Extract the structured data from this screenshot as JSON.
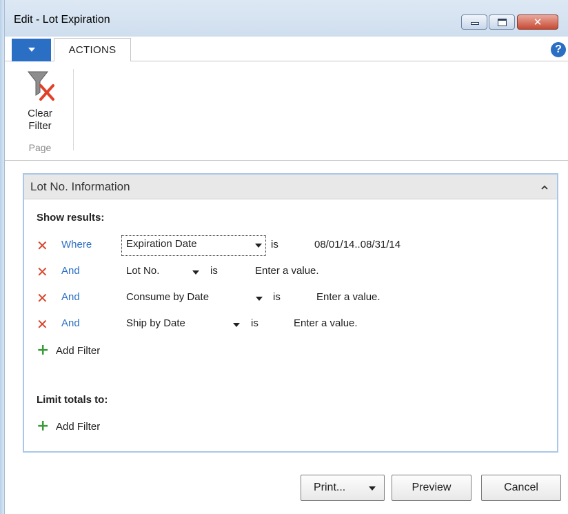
{
  "window": {
    "title": "Edit - Lot Expiration"
  },
  "ribbon": {
    "menu_icon": "dropdown-caret-icon",
    "tabs": [
      {
        "label": "ACTIONS"
      }
    ],
    "help_glyph": "?",
    "actions": [
      {
        "label_line1": "Clear",
        "label_line2": "Filter",
        "icon": "clear-filter-icon"
      }
    ],
    "group_label": "Page"
  },
  "fasttab": {
    "title": "Lot No. Information",
    "show_results_label": "Show results:",
    "filters": [
      {
        "connector": "Where",
        "field": "Expiration Date",
        "operator": "is",
        "value": "08/01/14..08/31/14"
      },
      {
        "connector": "And",
        "field": "Lot No.",
        "operator": "is",
        "value": "Enter a value."
      },
      {
        "connector": "And",
        "field": "Consume by Date",
        "operator": "is",
        "value": "Enter a value."
      },
      {
        "connector": "And",
        "field": "Ship by Date",
        "operator": "is",
        "value": "Enter a value."
      }
    ],
    "add_filter_label": "Add Filter",
    "limit_totals_label": "Limit totals to:",
    "limit_add_filter_label": "Add Filter"
  },
  "buttons": {
    "print": "Print...",
    "preview": "Preview",
    "cancel": "Cancel"
  },
  "colors": {
    "accent": "#2b6fc4",
    "remove": "#d8432a",
    "add": "#3b9b3b"
  }
}
